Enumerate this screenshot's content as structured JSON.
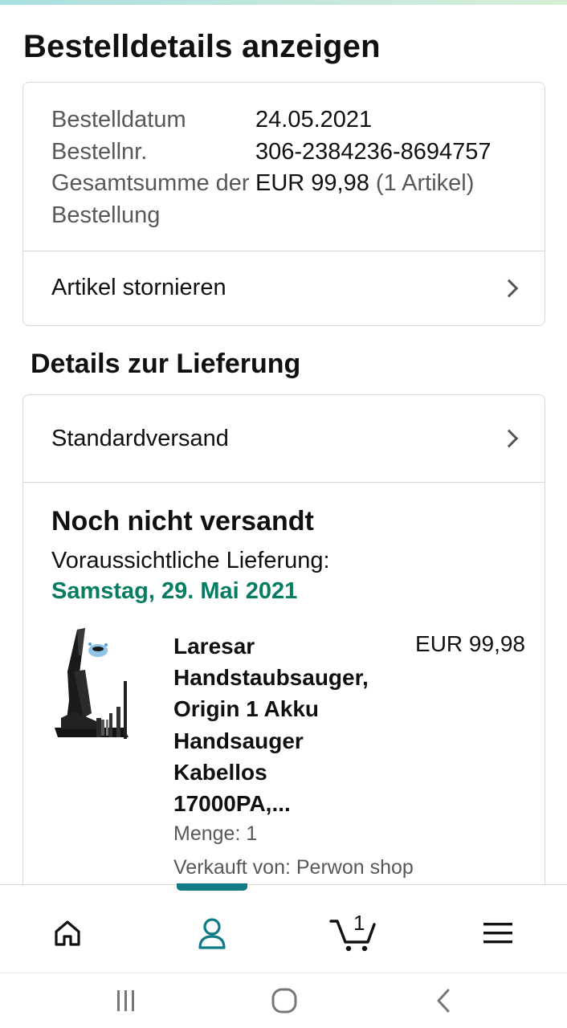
{
  "page": {
    "title": "Bestelldetails anzeigen"
  },
  "order_summary": {
    "rows": [
      {
        "label": "Bestelldatum",
        "value": "24.05.2021"
      },
      {
        "label": "Bestellnr.",
        "value": "306-2384236-8694757"
      },
      {
        "label": "Gesamtsumme der Bestellung",
        "value": "EUR 99,98",
        "extra": "(1 Artikel)"
      }
    ],
    "cancel_link": "Artikel stornieren"
  },
  "delivery": {
    "section_title": "Details zur Lieferung",
    "shipping_method": "Standardversand",
    "status": "Noch nicht versandt",
    "expected_label": "Voraussichtliche Lieferung:",
    "expected_date": "Samstag, 29. Mai 2021",
    "date_color": "#067d62"
  },
  "product": {
    "title": "Laresar Handstaubsauger, Origin 1 Akku Handsauger Kabellos 17000PA,...",
    "price": "EUR 99,98",
    "quantity": "Menge: 1",
    "seller": "Verkauft von: Perwon shop",
    "image_icon": "handheld-vacuum-image"
  },
  "bottom_nav": {
    "items": [
      {
        "name": "home",
        "icon": "home-icon"
      },
      {
        "name": "account",
        "icon": "account-icon",
        "active": true
      },
      {
        "name": "cart",
        "icon": "cart-icon",
        "count": "1"
      },
      {
        "name": "menu",
        "icon": "menu-icon"
      }
    ],
    "accent": "#0f7b86"
  },
  "system_nav": {
    "items": [
      "recent-apps-icon",
      "home-circle-icon",
      "back-icon"
    ]
  }
}
